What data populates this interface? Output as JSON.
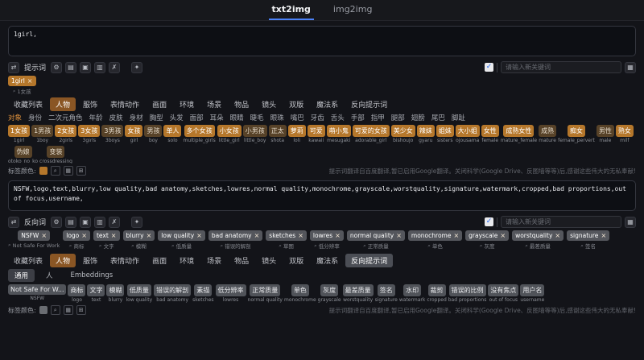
{
  "ui": {
    "close_glyph": "×",
    "check_glyph": "✓",
    "magnifier_glyph": "⌕"
  },
  "header": {
    "tabs": [
      {
        "label": "txt2img",
        "state": "active"
      },
      {
        "label": "img2img",
        "state": ""
      }
    ]
  },
  "positive": {
    "value": "1girl,",
    "toolbar": {
      "label": "提示词",
      "icons": [
        {
          "name": "translate-icon",
          "glyph": "⇄"
        },
        {
          "name": "settings-icon",
          "glyph": "⚙"
        },
        {
          "name": "history-icon",
          "glyph": "▤"
        },
        {
          "name": "copy-icon",
          "glyph": "▣"
        },
        {
          "name": "paste-icon",
          "glyph": "▥"
        },
        {
          "name": "clear-icon",
          "glyph": "✗"
        },
        {
          "name": "magic-icon",
          "glyph": "✦"
        }
      ],
      "checkbox_checked": true,
      "input_placeholder": "请输入新关键词",
      "expand_glyph": "▦"
    },
    "chips": [
      {
        "text": "1girl",
        "translation": "1女孩"
      }
    ],
    "tabs": [
      {
        "label": "收藏列表",
        "state": ""
      },
      {
        "label": "人物",
        "state": "active"
      },
      {
        "label": "服饰",
        "state": ""
      },
      {
        "label": "表情动作",
        "state": ""
      },
      {
        "label": "画面",
        "state": ""
      },
      {
        "label": "环境",
        "state": ""
      },
      {
        "label": "场景",
        "state": ""
      },
      {
        "label": "物品",
        "state": ""
      },
      {
        "label": "镜头",
        "state": ""
      },
      {
        "label": "双版",
        "state": ""
      },
      {
        "label": "魔法系",
        "state": ""
      },
      {
        "label": "反向提示词",
        "state": ""
      }
    ],
    "categories": [
      {
        "label": "对象",
        "state": "active"
      },
      {
        "label": "身份",
        "state": ""
      },
      {
        "label": "二次元角色",
        "state": ""
      },
      {
        "label": "年龄",
        "state": ""
      },
      {
        "label": "皮肤",
        "state": ""
      },
      {
        "label": "身材",
        "state": ""
      },
      {
        "label": "胸型",
        "state": ""
      },
      {
        "label": "头发",
        "state": ""
      },
      {
        "label": "面部",
        "state": ""
      },
      {
        "label": "耳朵",
        "state": ""
      },
      {
        "label": "眼睛",
        "state": ""
      },
      {
        "label": "睫毛",
        "state": ""
      },
      {
        "label": "眼珠",
        "state": ""
      },
      {
        "label": "嘴巴",
        "state": ""
      },
      {
        "label": "牙齿",
        "state": ""
      },
      {
        "label": "舌头",
        "state": ""
      },
      {
        "label": "手部",
        "state": ""
      },
      {
        "label": "指甲",
        "state": ""
      },
      {
        "label": "腿部",
        "state": ""
      },
      {
        "label": "翅膀",
        "state": ""
      },
      {
        "label": "尾巴",
        "state": ""
      },
      {
        "label": "脚趾",
        "state": ""
      }
    ],
    "tags": [
      {
        "zh": "1女孩",
        "en": "1girl",
        "variant": "bright"
      },
      {
        "zh": "1男孩",
        "en": "1boy",
        "variant": "dark"
      },
      {
        "zh": "2女孩",
        "en": "2girls",
        "variant": "bright"
      },
      {
        "zh": "3女孩",
        "en": "3girls",
        "variant": "bright"
      },
      {
        "zh": "3男孩",
        "en": "3boys",
        "variant": "dark"
      },
      {
        "zh": "女孩",
        "en": "girl",
        "variant": "bright"
      },
      {
        "zh": "男孩",
        "en": "boy",
        "variant": "dark"
      },
      {
        "zh": "单人",
        "en": "solo",
        "variant": "bright"
      },
      {
        "zh": "多个女孩",
        "en": "multiple_girls",
        "variant": "bright"
      },
      {
        "zh": "小女孩",
        "en": "little_girl",
        "variant": "bright"
      },
      {
        "zh": "小男孩",
        "en": "little_boy",
        "variant": "dark"
      },
      {
        "zh": "正太",
        "en": "shota",
        "variant": "dark"
      },
      {
        "zh": "萝莉",
        "en": "loli",
        "variant": "bright"
      },
      {
        "zh": "可爱",
        "en": "kawaii",
        "variant": "bright"
      },
      {
        "zh": "萌小鬼",
        "en": "mesugaki",
        "variant": "bright"
      },
      {
        "zh": "可爱的女孩",
        "en": "adorable_girl",
        "variant": "bright"
      },
      {
        "zh": "美少女",
        "en": "bishoujo",
        "variant": "bright"
      },
      {
        "zh": "辣妹",
        "en": "gyaru",
        "variant": "bright"
      },
      {
        "zh": "姐妹",
        "en": "sisters",
        "variant": "bright"
      },
      {
        "zh": "大小姐",
        "en": "ojousama",
        "variant": "bright"
      },
      {
        "zh": "女性",
        "en": "female",
        "variant": "bright"
      },
      {
        "zh": "成熟女性",
        "en": "mature_female",
        "variant": "bright"
      },
      {
        "zh": "成熟",
        "en": "mature",
        "variant": "dark"
      },
      {
        "zh": "痴女",
        "en": "female_pervert",
        "variant": "bright"
      },
      {
        "zh": "男性",
        "en": "male",
        "variant": "dark"
      },
      {
        "zh": "熟女",
        "en": "milf",
        "variant": "bright"
      },
      {
        "zh": "伪娘",
        "en": "otoko_no_ko",
        "variant": "dark"
      },
      {
        "zh": "变装",
        "en": "crossdressing",
        "variant": "dark"
      }
    ],
    "color_label": "标签颜色:",
    "swatch_color": "#b5772b",
    "swatch_icons": [
      "⌕",
      "▦",
      "⊞"
    ],
    "note": "提示词翻译自百度翻译,暂已启用Google翻译。关闭科学(Google Drive、反图墙等等)后,感谢这些伟大的无私奉献!"
  },
  "negative": {
    "value": "NSFW,logo,text,blurry,low quality,bad anatomy,sketches,lowres,normal quality,monochrome,grayscale,worstquality,signature,watermark,cropped,bad proportions,out of focus,username,",
    "toolbar": {
      "label": "反向词",
      "icons": [
        {
          "name": "translate-icon",
          "glyph": "⇄"
        },
        {
          "name": "settings-icon",
          "glyph": "⚙"
        },
        {
          "name": "history-icon",
          "glyph": "▤"
        },
        {
          "name": "copy-icon",
          "glyph": "▣"
        },
        {
          "name": "paste-icon",
          "glyph": "▥"
        },
        {
          "name": "clear-icon",
          "glyph": "✗"
        },
        {
          "name": "magic-icon",
          "glyph": "✦"
        }
      ],
      "checkbox_checked": true,
      "input_placeholder": "请输入新关键词",
      "expand_glyph": "▦"
    },
    "chips": [
      {
        "text": "NSFW",
        "translation": "Not Safe For Work"
      },
      {
        "text": "logo",
        "translation": "商标"
      },
      {
        "text": "text",
        "translation": "文字"
      },
      {
        "text": "blurry",
        "translation": "模糊"
      },
      {
        "text": "low quality",
        "translation": "低质量"
      },
      {
        "text": "bad anatomy",
        "translation": "错误的解剖"
      },
      {
        "text": "sketches",
        "translation": "草图"
      },
      {
        "text": "lowres",
        "translation": "低分辨率"
      },
      {
        "text": "normal quality",
        "translation": "正常质量"
      },
      {
        "text": "monochrome",
        "translation": "单色"
      },
      {
        "text": "grayscale",
        "translation": "灰度"
      },
      {
        "text": "worstquality",
        "translation": "最差质量"
      },
      {
        "text": "signature",
        "translation": "签名"
      },
      {
        "text": "watermark",
        "translation": "水印"
      },
      {
        "text": "cropped",
        "translation": "裁剪"
      },
      {
        "text": "bad proportions",
        "translation": "糟糕的比例"
      },
      {
        "text": "out of focus",
        "translation": "没有焦点"
      },
      {
        "text": "username",
        "translation": "用户名"
      }
    ],
    "tabs": [
      {
        "label": "收藏列表",
        "state": ""
      },
      {
        "label": "人物",
        "state": "active"
      },
      {
        "label": "服饰",
        "state": ""
      },
      {
        "label": "表情动作",
        "state": ""
      },
      {
        "label": "画面",
        "state": ""
      },
      {
        "label": "环境",
        "state": ""
      },
      {
        "label": "场景",
        "state": ""
      },
      {
        "label": "物品",
        "state": ""
      },
      {
        "label": "镜头",
        "state": ""
      },
      {
        "label": "双版",
        "state": ""
      },
      {
        "label": "魔法系",
        "state": ""
      },
      {
        "label": "反向提示词",
        "state": "selected"
      }
    ],
    "subtabs": [
      {
        "label": "通用",
        "state": "active"
      },
      {
        "label": "人",
        "state": ""
      },
      {
        "label": "Embeddings",
        "state": ""
      }
    ],
    "tags": [
      {
        "zh": "Not Safe For W...",
        "en": "NSFW"
      },
      {
        "zh": "商标",
        "en": "logo"
      },
      {
        "zh": "文字",
        "en": "text"
      },
      {
        "zh": "模糊",
        "en": "blurry"
      },
      {
        "zh": "低质量",
        "en": "low quality"
      },
      {
        "zh": "错误的解剖",
        "en": "bad anatomy"
      },
      {
        "zh": "素描",
        "en": "sketches"
      },
      {
        "zh": "低分辨率",
        "en": "lowres"
      },
      {
        "zh": "正常质量",
        "en": "normal quality"
      },
      {
        "zh": "单色",
        "en": "monochrome"
      },
      {
        "zh": "灰度",
        "en": "grayscale"
      },
      {
        "zh": "最差质量",
        "en": "worstquality"
      },
      {
        "zh": "签名",
        "en": "signature"
      },
      {
        "zh": "水印",
        "en": "watermark"
      },
      {
        "zh": "裁剪",
        "en": "cropped"
      },
      {
        "zh": "错误的比例",
        "en": "bad proportions"
      },
      {
        "zh": "没有焦点",
        "en": "out of focus"
      },
      {
        "zh": "用户名",
        "en": "username"
      }
    ],
    "color_label": "标签颜色:",
    "swatch_color": "#6a6d72",
    "swatch_icons": [
      "⌕",
      "▦",
      "⊞"
    ],
    "note": "提示词翻译自百度翻译,暂已启用Google翻译。关闭科学(Google Drive、反图墙等等)后,感谢这些伟大的无私奉献!"
  }
}
